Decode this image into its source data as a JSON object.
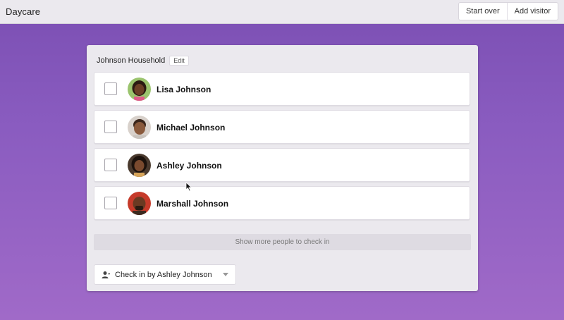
{
  "header": {
    "app_title": "Daycare",
    "start_over_label": "Start over",
    "add_visitor_label": "Add visitor"
  },
  "household": {
    "name": "Johnson Household",
    "edit_label": "Edit"
  },
  "people": [
    {
      "name": "Lisa Johnson",
      "checked": false,
      "avatar": "child-avatar-1"
    },
    {
      "name": "Michael Johnson",
      "checked": false,
      "avatar": "child-avatar-2"
    },
    {
      "name": "Ashley Johnson",
      "checked": false,
      "avatar": "adult-avatar-1"
    },
    {
      "name": "Marshall Johnson",
      "checked": false,
      "avatar": "adult-avatar-2"
    }
  ],
  "show_more_label": "Show more people to check in",
  "checkin_by": {
    "label": "Check in by Ashley Johnson",
    "icon": "person-icon"
  },
  "colors": {
    "accent_top": "#7b4fb3",
    "accent_bottom": "#a06ac8",
    "panel": "#ebe9ee"
  }
}
